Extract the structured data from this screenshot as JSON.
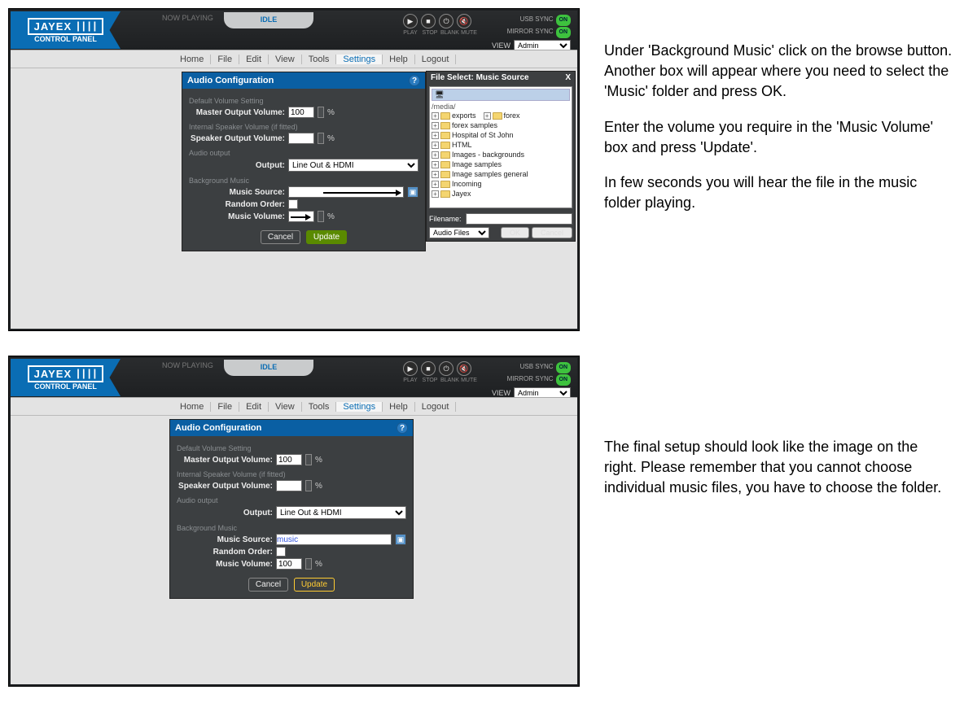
{
  "doc": {
    "para1a": "Under 'Background Music' click on the browse button.  Another box will appear where you need to select the 'Music' folder and press OK.",
    "para1b": "Enter the volume you require in the 'Music Volume' box and press 'Update'.",
    "para1c": "In few seconds you will hear the file in the music folder playing.",
    "para2": "The final setup should look like the image on the right.  Please remember that you cannot choose individual music files, you have to choose the folder."
  },
  "app": {
    "brand": "JAYEX",
    "brand_sub": "CONTROL PANEL",
    "now_playing": "NOW PLAYING",
    "idle": "IDLE",
    "media_play": "PLAY",
    "media_stop": "STOP",
    "media_blank": "BLANK",
    "media_mute": "MUTE",
    "usb_sync": "USB SYNC",
    "mirror_sync": "MIRROR SYNC",
    "on": "ON",
    "view_label": "VIEW",
    "view_value": "Admin"
  },
  "menu": {
    "home": "Home",
    "file": "File",
    "edit": "Edit",
    "view": "View",
    "tools": "Tools",
    "settings": "Settings",
    "help": "Help",
    "logout": "Logout"
  },
  "dialog": {
    "title": "Audio Configuration",
    "sec1": "Default Volume Setting",
    "master": "Master Output Volume:",
    "master_val": "100",
    "pct": "%",
    "sec2": "Internal Speaker Volume (if fitted)",
    "speaker": "Speaker Output Volume:",
    "sec3": "Audio output",
    "output": "Output:",
    "output_val": "Line Out & HDMI",
    "sec4": "Background Music",
    "source": "Music Source:",
    "source_val2": "music",
    "random": "Random Order:",
    "volume": "Music Volume:",
    "volume_val2": "100",
    "cancel": "Cancel",
    "update": "Update"
  },
  "fs": {
    "title": "File Select: Music Source",
    "close": "X",
    "path": "/media/",
    "items": [
      "exports",
      "forex",
      "forex samples",
      "Hospital of St John",
      "HTML",
      "Images - backgrounds",
      "Image samples",
      "Image samples general",
      "Incoming",
      "Jayex"
    ],
    "filename_label": "Filename:",
    "filter": "Audio Files",
    "ok": "OK",
    "cancel": "Cancel"
  }
}
